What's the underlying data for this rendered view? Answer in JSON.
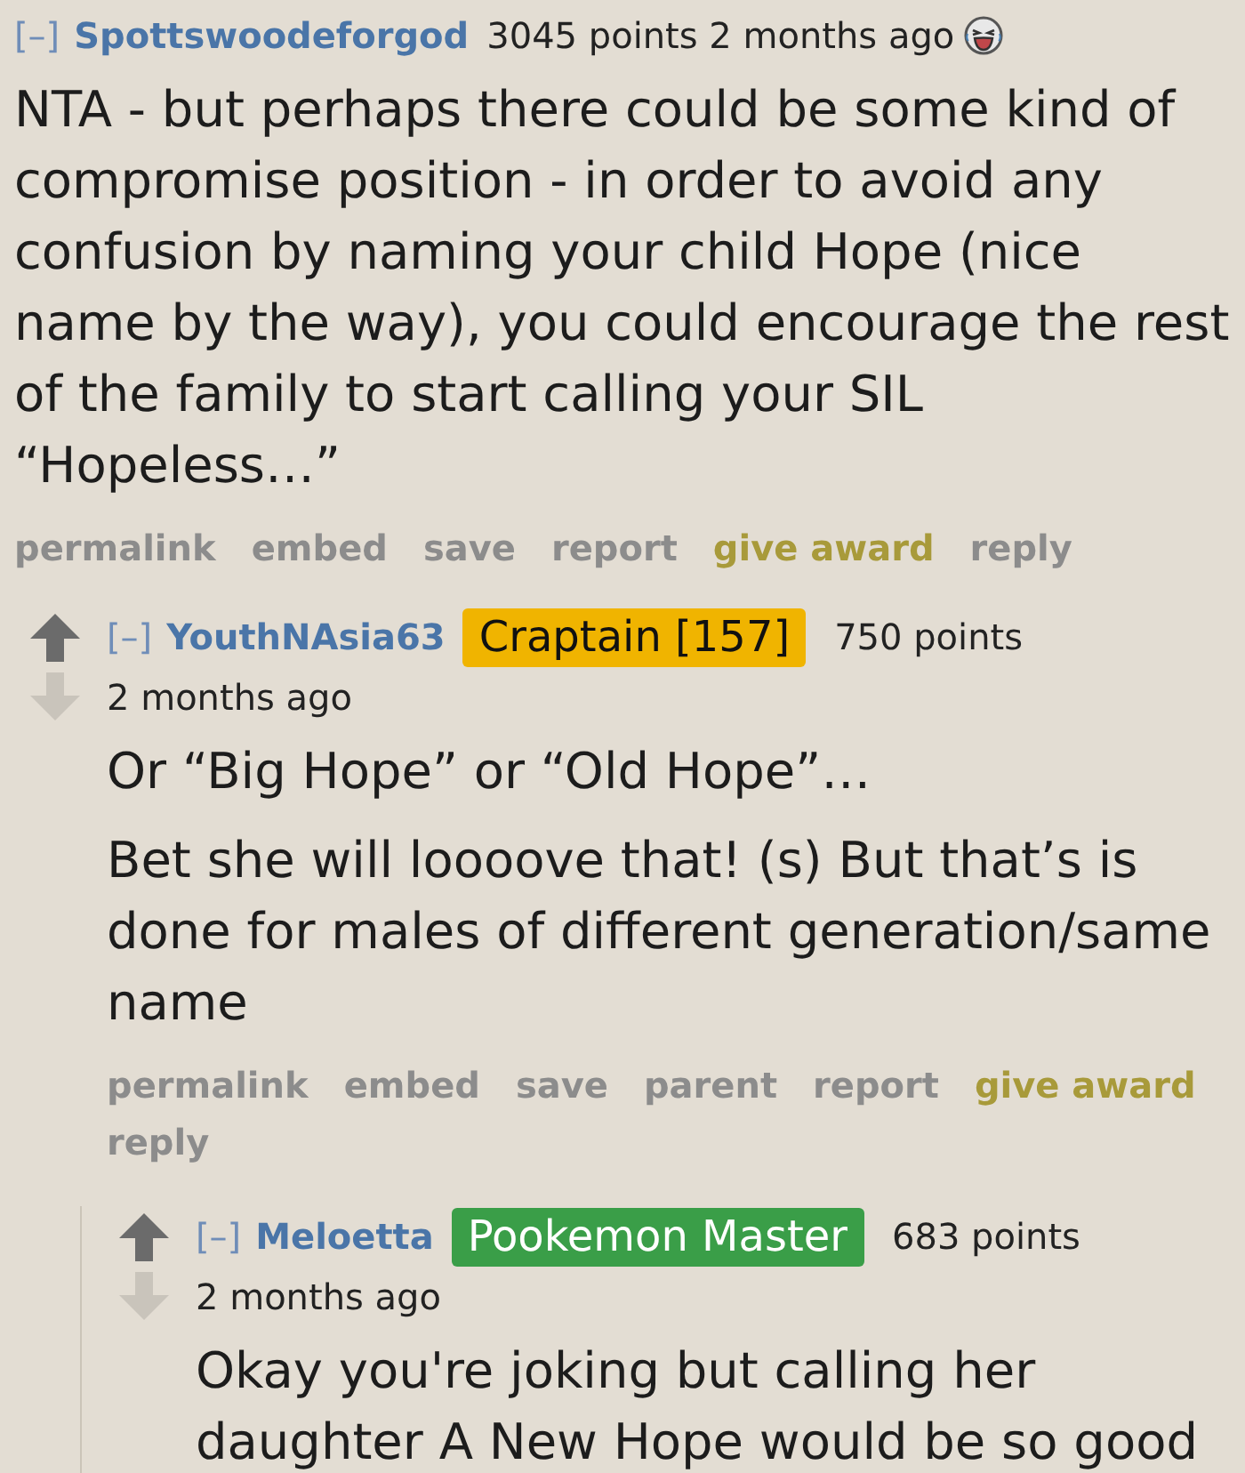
{
  "comments": [
    {
      "collapse_toggle": "[–]",
      "author": "Spottswoodeforgod",
      "score": "3045 points",
      "time": "2 months ago",
      "award": true,
      "body": [
        "NTA - but perhaps there could be some kind of compromise position - in order to avoid any confusion by naming your child Hope (nice name by the way), you could encourage the rest of the family to start calling your SIL “Hopeless…”"
      ],
      "actions": [
        {
          "label": "permalink",
          "kind": "plain"
        },
        {
          "label": "embed",
          "kind": "plain"
        },
        {
          "label": "save",
          "kind": "plain"
        },
        {
          "label": "report",
          "kind": "plain"
        },
        {
          "label": "give award",
          "kind": "award"
        },
        {
          "label": "reply",
          "kind": "plain"
        }
      ],
      "children": [
        {
          "vote_arrows": true,
          "collapse_toggle": "[–]",
          "author": "YouthNAsia63",
          "flair": {
            "text": "Craptain [157]",
            "color": "#f0b400"
          },
          "score": "750 points",
          "time": "2 months ago",
          "body": [
            "Or “Big Hope” or “Old Hope”…",
            "Bet she will loooove that! (s) But that’s is done for males of different generation/same name"
          ],
          "actions": [
            {
              "label": "permalink",
              "kind": "plain"
            },
            {
              "label": "embed",
              "kind": "plain"
            },
            {
              "label": "save",
              "kind": "plain"
            },
            {
              "label": "parent",
              "kind": "plain"
            },
            {
              "label": "report",
              "kind": "plain"
            },
            {
              "label": "give award",
              "kind": "award"
            },
            {
              "label": "reply",
              "kind": "plain"
            }
          ],
          "children": [
            {
              "vote_arrows": true,
              "collapse_toggle": "[–]",
              "author": "Meloetta",
              "flair": {
                "text": "Pookemon Master",
                "color": "#3a9e48"
              },
              "score": "683 points",
              "time": "2 months ago",
              "body": [
                "Okay you're joking but calling her daughter A New Hope would be so good"
              ]
            }
          ]
        }
      ]
    }
  ]
}
